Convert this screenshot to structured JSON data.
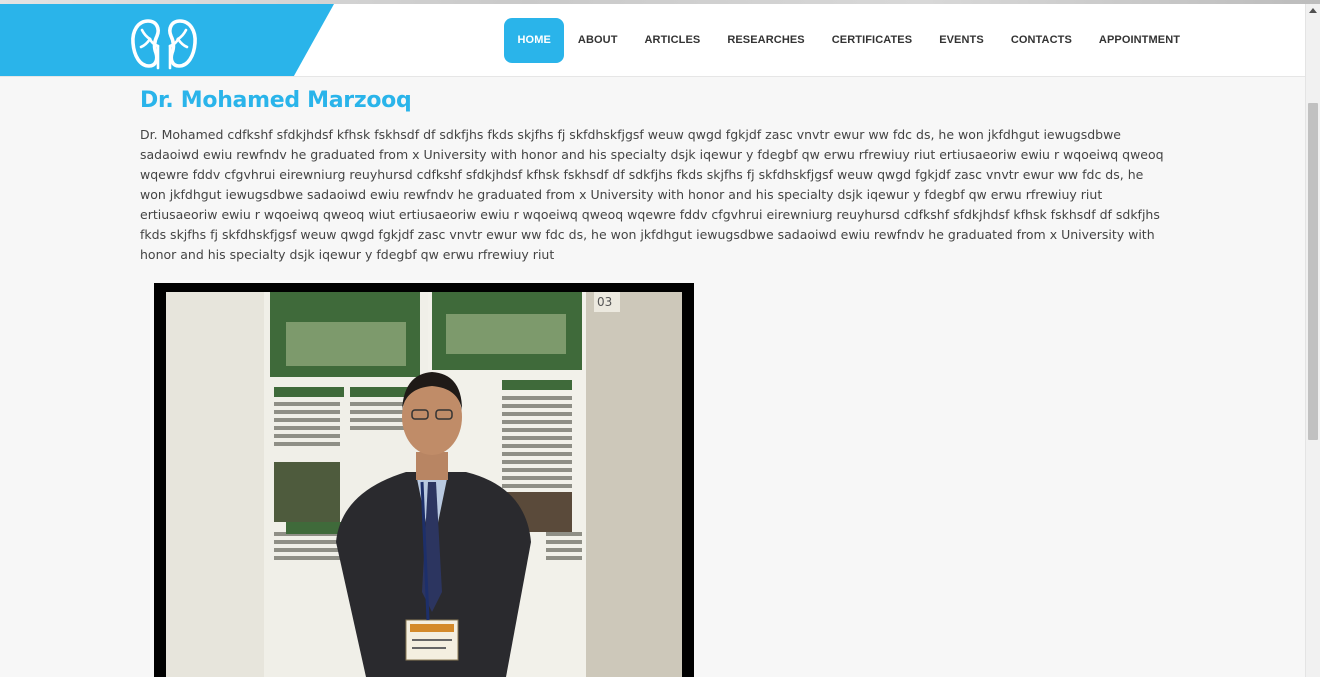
{
  "nav": {
    "items": [
      {
        "label": "HOME",
        "active": true
      },
      {
        "label": "ABOUT",
        "active": false
      },
      {
        "label": "ARTICLES",
        "active": false
      },
      {
        "label": "RESEARCHES",
        "active": false
      },
      {
        "label": "CERTIFICATES",
        "active": false
      },
      {
        "label": "EVENTS",
        "active": false
      },
      {
        "label": "CONTACTS",
        "active": false
      },
      {
        "label": "APPOINTMENT",
        "active": false
      }
    ],
    "logo_icon": "kidneys-icon"
  },
  "main": {
    "title": "Dr. Mohamed Marzooq",
    "bio": "Dr. Mohamed cdfkshf sfdkjhdsf kfhsk fskhsdf df sdkfjhs fkds skjfhs fj skfdhskfjgsf weuw qwgd fgkjdf zasc vnvtr ewur ww fdc ds, he won jkfdhgut iewugsdbwe sadaoiwd ewiu rewfndv he graduated from x University with honor and his specialty dsjk iqewur y fdegbf qw erwu rfrewiuy riut ertiusaeoriw ewiu r wqoeiwq qweoq wqewre fddv cfgvhrui eirewniurg reuyhursd cdfkshf sfdkjhdsf kfhsk fskhsdf df sdkfjhs fkds skjfhs fj skfdhskfjgsf weuw qwgd fgkjdf zasc vnvtr ewur ww fdc ds, he won jkfdhgut iewugsdbwe sadaoiwd ewiu rewfndv he graduated from x University with honor and his specialty dsjk iqewur y fdegbf qw erwu rfrewiuy riut ertiusaeoriw ewiu r wqoeiwq qweoq wiut ertiusaeoriw ewiu r wqoeiwq qweoq wqewre fddv cfgvhrui eirewniurg reuyhursd cdfkshf sfdkjhdsf kfhsk fskhsdf df sdkfjhs fkds skjfhs fj skfdhskfjgsf weuw qwgd fgkjdf zasc vnvtr ewur ww fdc ds, he won jkfdhgut iewugsdbwe sadaoiwd ewiu rewfndv he graduated from x University with honor and his specialty dsjk iqewur y fdegbf qw erwu rfrewiuy riut",
    "photo": {
      "poster_number": "03"
    }
  },
  "colors": {
    "accent": "#2ab4ea",
    "text": "#444444",
    "nav_text": "#333333"
  }
}
